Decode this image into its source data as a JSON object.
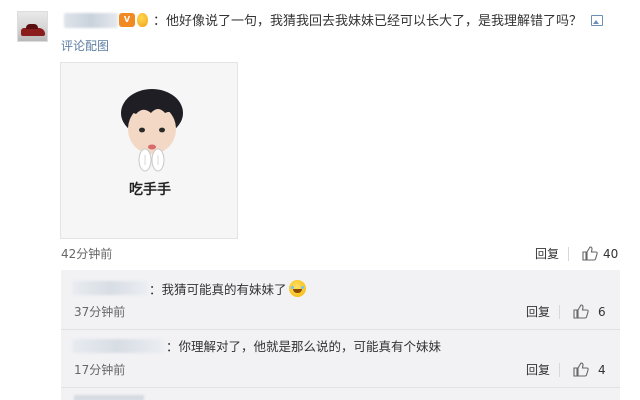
{
  "comment": {
    "text": "：他好像说了一句，我猜我回去我妹妹已经可以长大了，是我理解错了吗？",
    "reply_image_link": "评论配图",
    "sticker_caption": "吃手手",
    "time": "42分钟前",
    "reply_label": "回复",
    "like_count": "40"
  },
  "replies": [
    {
      "text": "：我猜可能真的有妹妹了",
      "emoji": "laughing-crying-emoji",
      "time": "37分钟前",
      "reply_label": "回复",
      "like_count": "6"
    },
    {
      "text": "：你理解对了，他就是那么说的，可能真有个妹妹",
      "time": "17分钟前",
      "reply_label": "回复",
      "like_count": "4"
    }
  ],
  "icons": {
    "image_attachment": "picture-icon",
    "like": "thumbs-up-icon",
    "vip_badge": "vip-badge-icon",
    "balloon_badge": "balloon-badge-icon"
  },
  "colors": {
    "link": "#5d7fa3",
    "reply_background": "#f2f2f5",
    "text": "#333333",
    "meta": "#666666"
  }
}
